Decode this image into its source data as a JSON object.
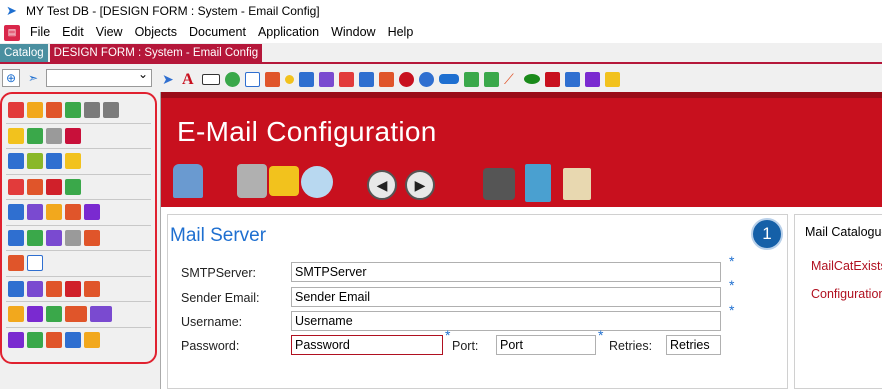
{
  "window": {
    "title": "MY Test DB - [DESIGN FORM : System - Email Config]"
  },
  "menu": {
    "items": [
      "File",
      "Edit",
      "View",
      "Objects",
      "Document",
      "Application",
      "Window",
      "Help"
    ]
  },
  "tabs": {
    "catalog": "Catalog",
    "design": "DESIGN FORM : System - Email Config"
  },
  "form": {
    "title": "E-Mail Configuration",
    "badge": "1",
    "mail_server": {
      "heading": "Mail Server",
      "smtp_label": "SMTPServer:",
      "smtp_value": "SMTPServer",
      "sender_label": "Sender Email:",
      "sender_value": "Sender Email",
      "username_label": "Username:",
      "username_value": "Username",
      "password_label": "Password:",
      "password_value": "Password",
      "port_label": "Port:",
      "port_value": "Port",
      "retries_label": "Retries:",
      "retries_value": "Retries",
      "required_mark": "*"
    },
    "catalog_panel": {
      "title": "Mail Catalogue",
      "items": [
        "MailCatExists",
        "Configuration"
      ]
    }
  },
  "colors": {
    "banner": "#c8101e",
    "accent": "#1e6fd0",
    "palette_border": "#e0212f"
  }
}
